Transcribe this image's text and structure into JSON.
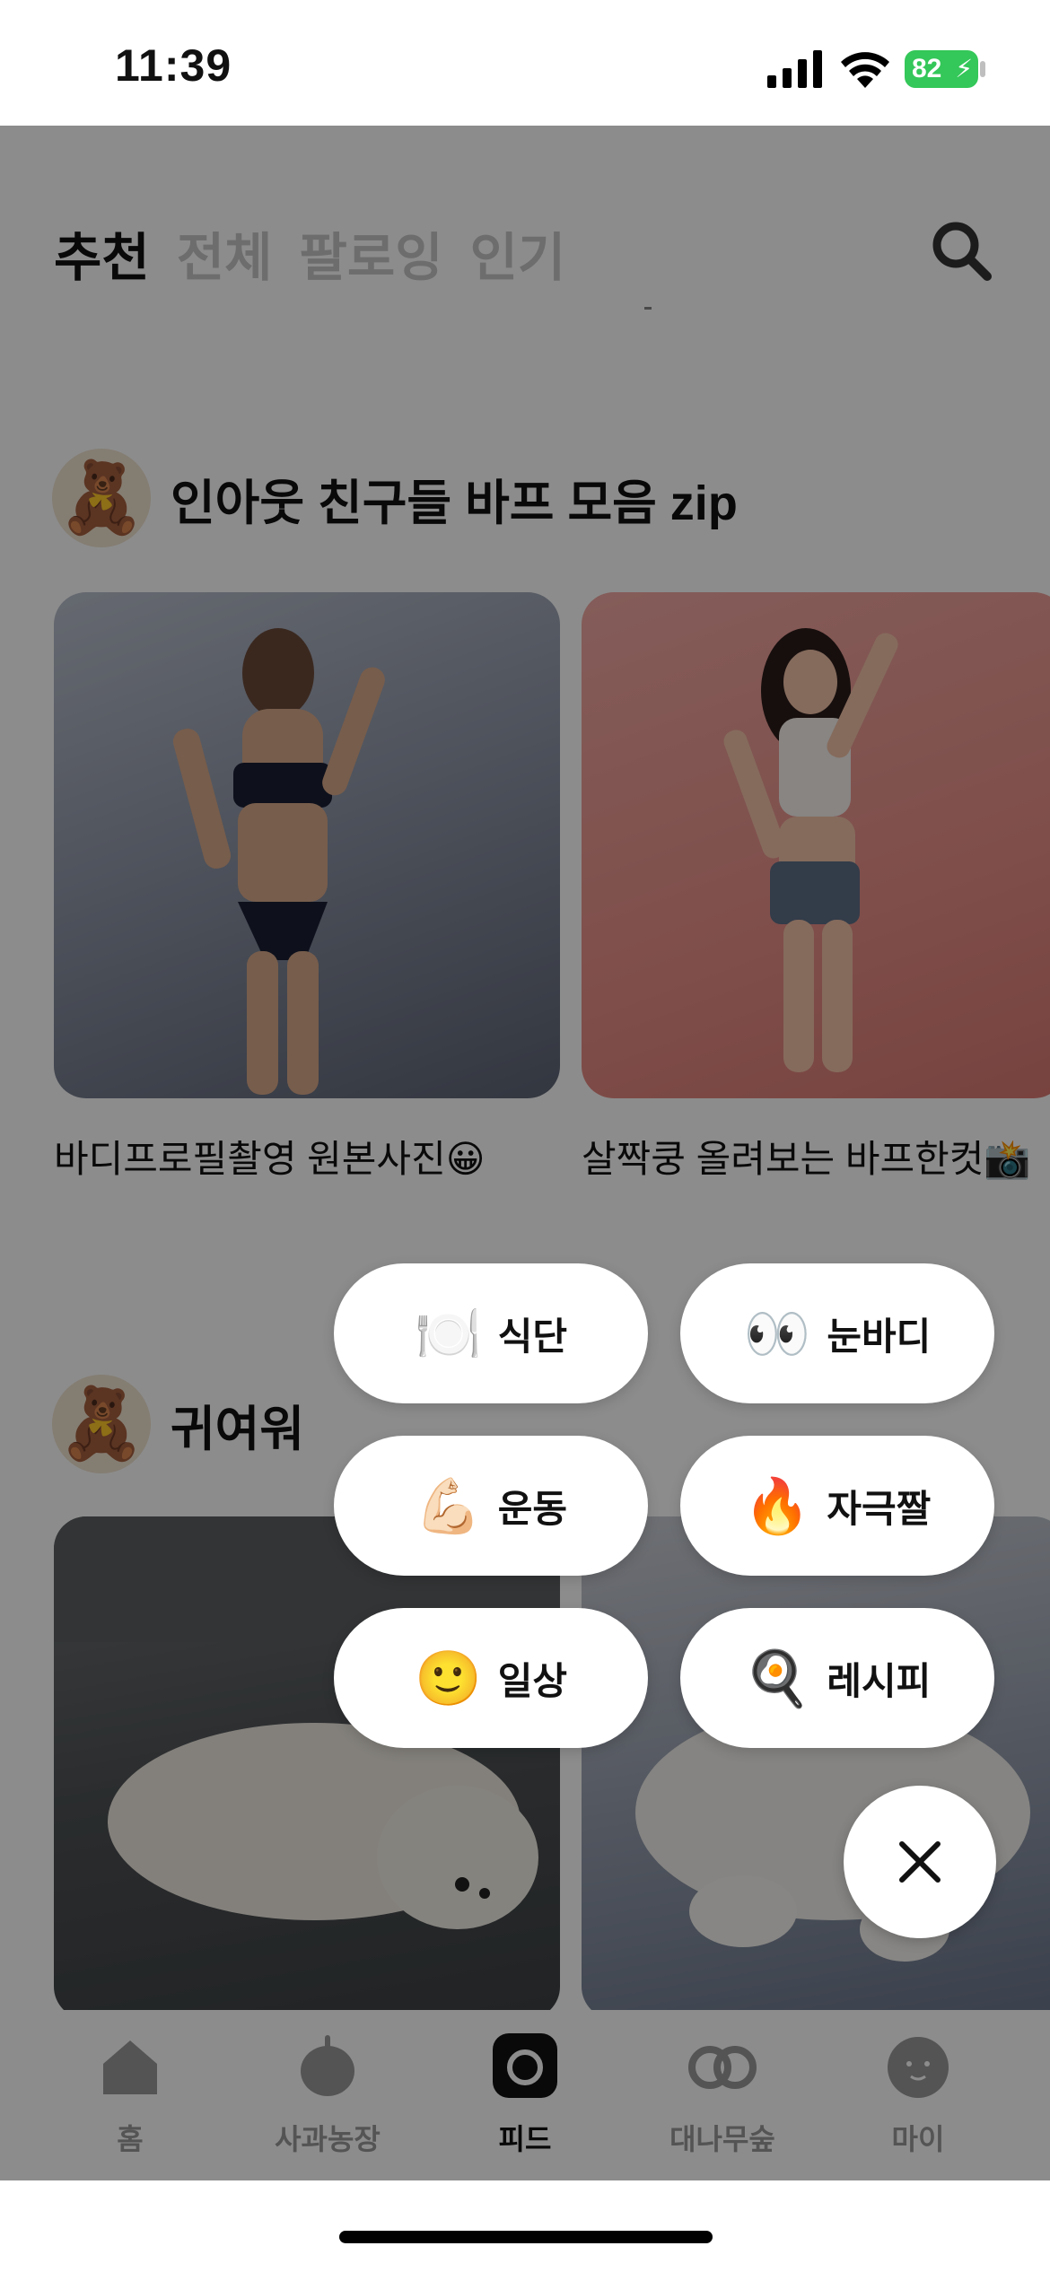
{
  "status_bar": {
    "time": "11:39",
    "battery": "82"
  },
  "header": {
    "tabs": [
      {
        "label": "추천",
        "active": true
      },
      {
        "label": "전체",
        "active": false
      },
      {
        "label": "팔로잉",
        "active": false
      },
      {
        "label": "인기",
        "active": false
      }
    ],
    "search_icon": "search-icon"
  },
  "sections": [
    {
      "title": "인아웃 친구들 바프 모음 zip",
      "sticker_icon": "bear-mirror-sticker",
      "cards": [
        {
          "caption": "바디프로필촬영 원본사진😀",
          "image": "woman-navy-swimwear-photo"
        },
        {
          "caption": "살짝쿵 올려보는 바프한컷📸",
          "image": "woman-pink-background-photo"
        }
      ]
    },
    {
      "title": "귀여워",
      "sticker_icon": "bear-heart-sticker",
      "cards": [
        {
          "caption": "",
          "image": "white-dog-on-sofa-photo"
        },
        {
          "caption": "",
          "image": "white-cat-on-blanket-photo"
        }
      ]
    }
  ],
  "category_menu": [
    {
      "emoji": "🍽️",
      "label": "식단"
    },
    {
      "emoji": "👀",
      "label": "눈바디"
    },
    {
      "emoji": "💪🏻",
      "label": "운동"
    },
    {
      "emoji": "🔥",
      "label": "자극짤"
    },
    {
      "emoji": "🙂",
      "label": "일상"
    },
    {
      "emoji": "🍳",
      "label": "레시피"
    }
  ],
  "close_button_icon": "close-icon",
  "bottom_nav": [
    {
      "label": "홈",
      "icon": "home-icon",
      "active": false
    },
    {
      "label": "사과농장",
      "icon": "apple-icon",
      "active": false
    },
    {
      "label": "피드",
      "icon": "camera-icon",
      "active": true
    },
    {
      "label": "대나무숲",
      "icon": "eyes-icon",
      "active": false
    },
    {
      "label": "마이",
      "icon": "profile-face-icon",
      "active": false
    }
  ],
  "colors": {
    "overlay": "#00000073",
    "battery": "#34c759",
    "chip_bg": "#ffffff"
  }
}
